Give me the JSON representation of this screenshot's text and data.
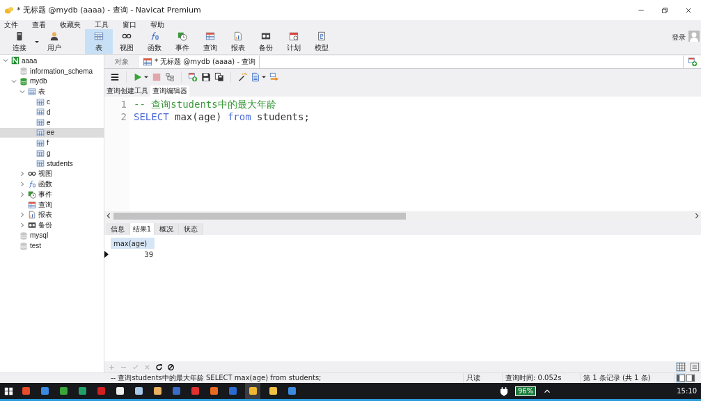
{
  "window": {
    "title": "* 无标题 @mydb (aaaa) - 查询 - Navicat Premium"
  },
  "menu": [
    "文件",
    "查看",
    "收藏夹",
    "工具",
    "窗口",
    "帮助"
  ],
  "toolbar": [
    {
      "label": "连接",
      "selected": false,
      "dropdown": true
    },
    {
      "label": "用户",
      "selected": false
    },
    {
      "label": "表",
      "selected": true
    },
    {
      "label": "视图",
      "selected": false
    },
    {
      "label": "函数",
      "selected": false
    },
    {
      "label": "事件",
      "selected": false
    },
    {
      "label": "查询",
      "selected": false
    },
    {
      "label": "报表",
      "selected": false
    },
    {
      "label": "备份",
      "selected": false
    },
    {
      "label": "计划",
      "selected": false
    },
    {
      "label": "模型",
      "selected": false
    }
  ],
  "login": "登录",
  "tree": [
    {
      "label": "aaaa",
      "kind": "connection",
      "expanded": true,
      "selected": false,
      "children": [
        {
          "label": "information_schema",
          "kind": "database-off",
          "selected": false
        },
        {
          "label": "mydb",
          "kind": "database",
          "expanded": true,
          "selected": false,
          "children": [
            {
              "label": "表",
              "kind": "tables",
              "expanded": true,
              "selected": false,
              "children": [
                {
                  "label": "c",
                  "kind": "table",
                  "selected": false
                },
                {
                  "label": "d",
                  "kind": "table",
                  "selected": false
                },
                {
                  "label": "e",
                  "kind": "table",
                  "selected": false
                },
                {
                  "label": "ee",
                  "kind": "table",
                  "selected": true
                },
                {
                  "label": "f",
                  "kind": "table",
                  "selected": false
                },
                {
                  "label": "g",
                  "kind": "table",
                  "selected": false
                },
                {
                  "label": "students",
                  "kind": "table",
                  "selected": false
                }
              ]
            },
            {
              "label": "视图",
              "kind": "views",
              "expanded": false,
              "selected": false
            },
            {
              "label": "函数",
              "kind": "functions",
              "expanded": false,
              "selected": false
            },
            {
              "label": "事件",
              "kind": "events",
              "expanded": false,
              "selected": false
            },
            {
              "label": "查询",
              "kind": "queries",
              "selected": false
            },
            {
              "label": "报表",
              "kind": "reports",
              "expanded": false,
              "selected": false
            },
            {
              "label": "备份",
              "kind": "backups",
              "expanded": false,
              "selected": false
            }
          ]
        },
        {
          "label": "mysql",
          "kind": "database-off",
          "selected": false
        },
        {
          "label": "test",
          "kind": "database-off",
          "selected": false
        }
      ]
    }
  ],
  "tabs": [
    {
      "label": "对象",
      "selected": false
    },
    {
      "label": "* 无标题 @mydb (aaaa) - 查询",
      "selected": true
    }
  ],
  "editor_tabs": [
    {
      "label": "查询创建工具",
      "selected": false
    },
    {
      "label": "查询编辑器",
      "selected": true
    }
  ],
  "editor": {
    "lines": [
      {
        "number": "1",
        "tokens": [
          {
            "text": "-- 查询students中的最大年龄",
            "kind": "comment"
          }
        ]
      },
      {
        "number": "2",
        "tokens": [
          {
            "text": "SELECT",
            "kind": "keyword"
          },
          {
            "text": " max(age) ",
            "kind": "plain"
          },
          {
            "text": "from",
            "kind": "keyword"
          },
          {
            "text": " students;",
            "kind": "plain"
          }
        ]
      }
    ]
  },
  "result_tabs": [
    {
      "label": "信息",
      "selected": false
    },
    {
      "label": "结果1",
      "selected": true
    },
    {
      "label": "概况",
      "selected": false
    },
    {
      "label": "状态",
      "selected": false
    }
  ],
  "result": {
    "columns": [
      "max(age)"
    ],
    "rows": [
      [
        "39"
      ]
    ]
  },
  "grid_buttons": [
    {
      "kind": "add",
      "disabled": true
    },
    {
      "kind": "remove",
      "disabled": true
    },
    {
      "kind": "apply",
      "disabled": true
    },
    {
      "kind": "discard",
      "disabled": true
    },
    {
      "kind": "refresh",
      "disabled": false
    },
    {
      "kind": "stop",
      "disabled": false
    }
  ],
  "status_bar": {
    "sql": "-- 查询students中的最大年龄 SELECT max(age) from students;",
    "mode": "只读",
    "query_time": "查询时间: 0.052s",
    "record": "第 1 条记录 (共 1 条)"
  },
  "taskbar": {
    "battery": "96%",
    "time": "15:10"
  }
}
